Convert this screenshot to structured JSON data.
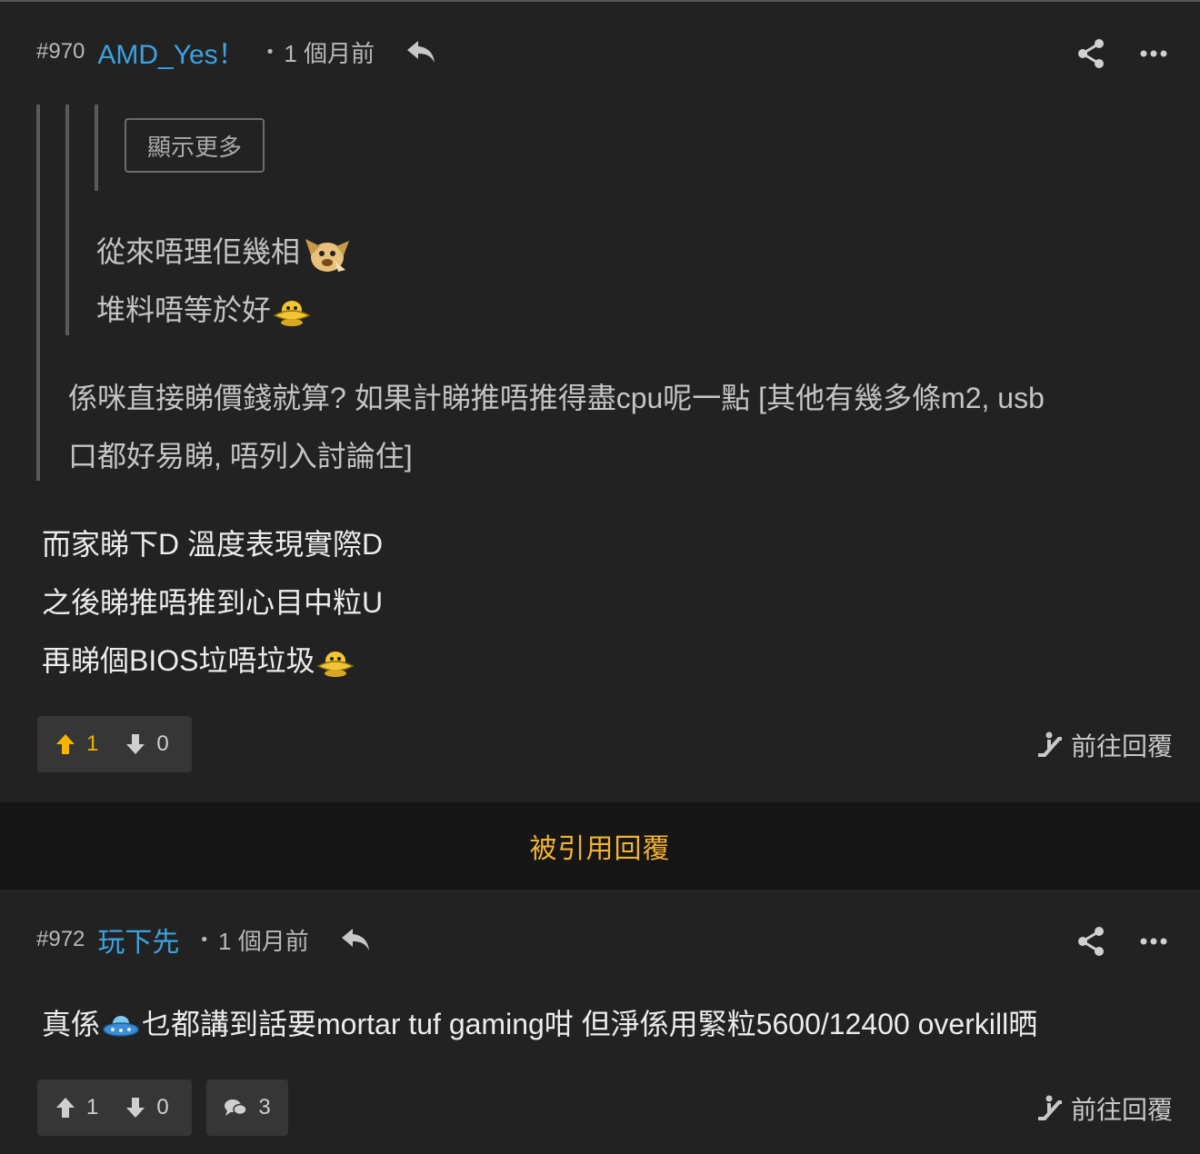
{
  "post1": {
    "number": "#970",
    "username": "AMD_Yes！",
    "dot": "•",
    "time": "1 個月前",
    "show_more_label": "顯示更多",
    "nested_quote_lines": [
      "從來唔理佢幾相",
      "堆料唔等於好"
    ],
    "quote_lines": [
      "係咪直接睇價錢就算? 如果計睇推唔推得盡cpu呢一點 [其他有幾多條m2, usb",
      "口都好易睇, 唔列入討論住]"
    ],
    "body_lines": [
      "而家睇下D 溫度表現實際D",
      "之後睇推唔推到心目中粒U",
      "再睇個BIOS垃唔垃圾"
    ],
    "upvotes": "1",
    "downvotes": "0",
    "goto_reply_label": "前往回覆",
    "upvote_color": "#f4b400"
  },
  "quoted_replies_label": "被引用回覆",
  "post2": {
    "number": "#972",
    "username": "玩下先",
    "dot": "•",
    "time": "1 個月前",
    "body_before_emoji": "真係",
    "body_after_emoji": "乜都講到話要mortar tuf gaming咁 但淨係用緊粒5600/12400 overkill晒",
    "upvotes": "1",
    "downvotes": "0",
    "comments": "3",
    "goto_reply_label": "前往回覆"
  },
  "colors": {
    "background": "#222222",
    "username": "#3ca2e0",
    "quoted_label": "#f2b233"
  }
}
